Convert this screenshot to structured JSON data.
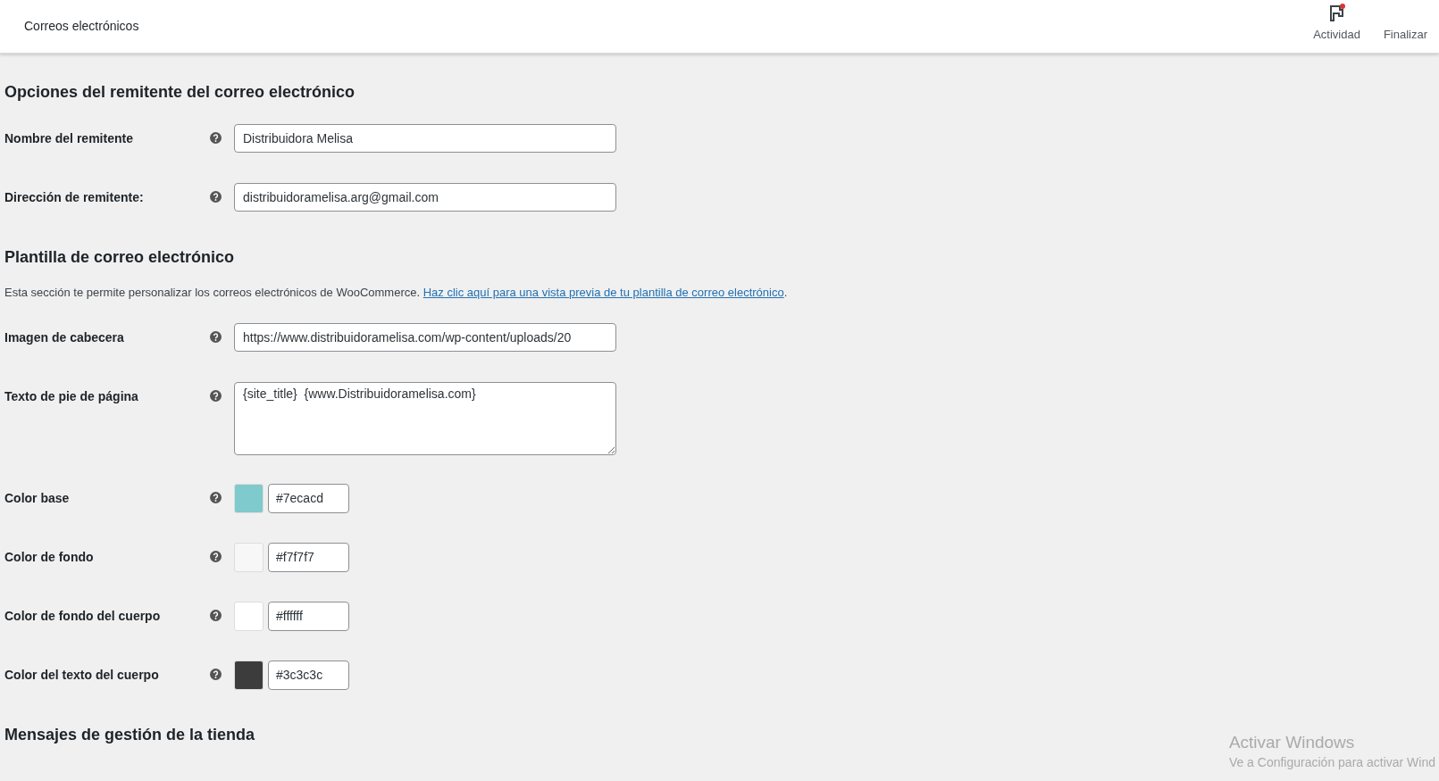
{
  "header": {
    "title": "Correos electrónicos",
    "actions": [
      {
        "label": "Actividad",
        "kind": "activity"
      },
      {
        "label": "Finalizar",
        "kind": "finish"
      }
    ]
  },
  "sections": [
    {
      "title": "Opciones del remitente del correo electrónico",
      "fields": [
        {
          "kind": "text",
          "label": "Nombre del remitente",
          "value": "Distribuidora Melisa"
        },
        {
          "kind": "text",
          "label": "Dirección de remitente:",
          "value": "distribuidoramelisa.arg@gmail.com"
        }
      ]
    },
    {
      "title": "Plantilla de correo electrónico",
      "description": "Esta sección te permite personalizar los correos electrónicos de WooCommerce.",
      "link": "Haz clic aquí para una vista previa de tu plantilla de correo electrónico",
      "link_end": ".",
      "fields": [
        {
          "kind": "text",
          "label": "Imagen de cabecera",
          "value": "https://www.distribuidoramelisa.com/wp-content/uploads/20"
        },
        {
          "kind": "textarea",
          "label": "Texto de pie de página",
          "value": "{site_title}  {www.Distribuidoramelisa.com}"
        },
        {
          "kind": "color",
          "label": "Color base",
          "value": "#7ecacd",
          "color": "#7ecacd"
        },
        {
          "kind": "color",
          "label": "Color de fondo",
          "value": "#f7f7f7",
          "color": "#f7f7f7"
        },
        {
          "kind": "color",
          "label": "Color de fondo del cuerpo",
          "value": "#ffffff",
          "color": "#ffffff"
        },
        {
          "kind": "color",
          "label": "Color del texto del cuerpo",
          "value": "#3c3c3c",
          "color": "#3c3c3c"
        }
      ]
    },
    {
      "title": "Mensajes de gestión de la tienda"
    }
  ],
  "os_notice": {
    "title": "Activar Windows",
    "subtitle": "Ve a Configuración para activar Wind"
  }
}
